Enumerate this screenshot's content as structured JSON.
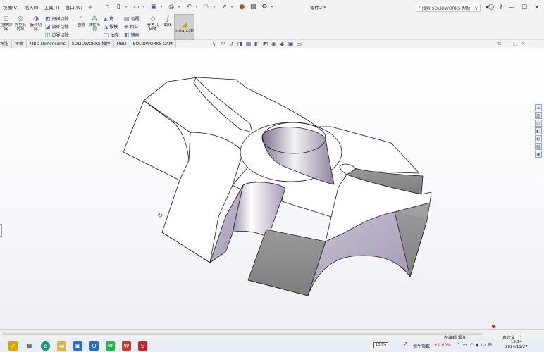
{
  "menu": [
    "视图(V)",
    "插入(I)",
    "工具(T)",
    "窗口(W)"
  ],
  "quick_access": {
    "icons": [
      "home-icon",
      "new-icon",
      "open-icon",
      "save-icon",
      "print-icon",
      "undo-icon",
      "redo-icon",
      "select-icon",
      "traffic-light-icon",
      "file-properties-icon",
      "options-icon"
    ]
  },
  "title": "零件2 *",
  "search": {
    "placeholder": "搜索 SOLIDWORKS 帮助"
  },
  "window_controls": {
    "minimize": "—",
    "maximize": "☐",
    "close": "✕"
  },
  "ribbon": {
    "cut_extrude": "拉伸切\n除",
    "hole_wizard": "异型孔\n向导",
    "revolve_cut": "旋转切\n除",
    "swept_cut": "扫描切除",
    "lofted_cut": "放样切除",
    "boundary_cut": "边界切除",
    "fillet": "圆角",
    "linear_pattern": "线性阵\n列",
    "rib": "筋",
    "draft": "拔模",
    "shell": "抽壳",
    "wrap": "包覆",
    "intersect": "相交",
    "mirror": "镜向",
    "ref_geometry": "参考几\n何体",
    "curves": "曲线",
    "instant3d": "Instant3D"
  },
  "tabs": [
    "评注",
    "评估",
    "MBD Dimensions",
    "SOLIDWORKS 插件",
    "MBD",
    "SOLIDWORKS CAM"
  ],
  "status": {
    "editing": "在编辑 零件",
    "units": "自定义"
  },
  "taskbar": {
    "battery": "100%",
    "stock_name": "恒生指数",
    "stock_change": "+1.60%",
    "ime": "中",
    "time": "15:14",
    "date": "2024/11/27"
  },
  "colors": {
    "accent": "#4a6fa5",
    "dark_face": "#8d8d8d",
    "purple_face": "#b6abc4",
    "stock_red": "#d33333"
  }
}
